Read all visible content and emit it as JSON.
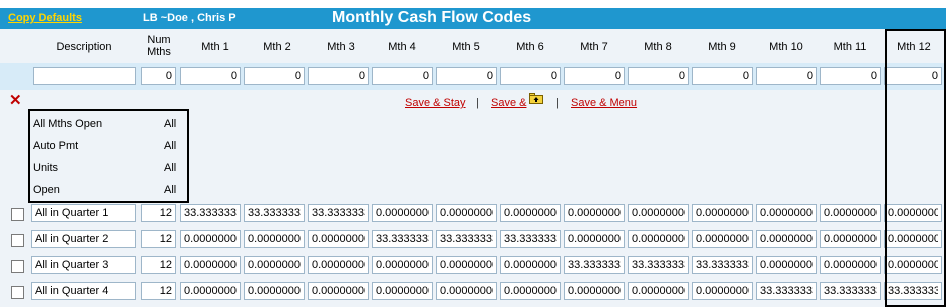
{
  "header": {
    "copy_defaults": "Copy Defaults",
    "user": "LB ~Doe , Chris P",
    "title": "Monthly Cash Flow Codes"
  },
  "columns": {
    "description": "Description",
    "num_mths": "Num Mths",
    "months": [
      "Mth 1",
      "Mth 2",
      "Mth 3",
      "Mth 4",
      "Mth 5",
      "Mth 6",
      "Mth 7",
      "Mth 8",
      "Mth 9",
      "Mth 10",
      "Mth 11",
      "Mth 12"
    ]
  },
  "input_row": {
    "description": "",
    "num_mths": "0",
    "months": [
      "0",
      "0",
      "0",
      "0",
      "0",
      "0",
      "0",
      "0",
      "0",
      "0",
      "0",
      "0"
    ]
  },
  "actions": {
    "save_stay": "Save & Stay",
    "save_and": "Save &",
    "save_menu": "Save & Menu",
    "separator": "|"
  },
  "options": [
    {
      "label": "All Mths Open",
      "value": "All"
    },
    {
      "label": "Auto Pmt",
      "value": "All"
    },
    {
      "label": "Units",
      "value": "All"
    },
    {
      "label": "Open",
      "value": "All"
    }
  ],
  "rows": [
    {
      "description": "All in Quarter 1",
      "num_mths": "12",
      "months": [
        "33.3333333",
        "33.3333333",
        "33.3333333",
        "0.00000000",
        "0.00000000",
        "0.00000000",
        "0.00000000",
        "0.00000000",
        "0.00000000",
        "0.00000000",
        "0.00000000",
        "0.00000000"
      ]
    },
    {
      "description": "All in Quarter 2",
      "num_mths": "12",
      "months": [
        "0.00000000",
        "0.00000000",
        "0.00000000",
        "33.3333333",
        "33.3333333",
        "33.3333333",
        "0.00000000",
        "0.00000000",
        "0.00000000",
        "0.00000000",
        "0.00000000",
        "0.00000000"
      ]
    },
    {
      "description": "All in Quarter 3",
      "num_mths": "12",
      "months": [
        "0.00000000",
        "0.00000000",
        "0.00000000",
        "0.00000000",
        "0.00000000",
        "0.00000000",
        "33.3333333",
        "33.3333333",
        "33.3333333",
        "0.00000000",
        "0.00000000",
        "0.00000000"
      ]
    },
    {
      "description": "All in Quarter 4",
      "num_mths": "12",
      "months": [
        "0.00000000",
        "0.00000000",
        "0.00000000",
        "0.00000000",
        "0.00000000",
        "0.00000000",
        "0.00000000",
        "0.00000000",
        "0.00000000",
        "33.3333333",
        "33.3333333",
        "33.3333333"
      ]
    }
  ],
  "colors": {
    "title_bar": "#1f97cf",
    "accent_link": "#c00000",
    "copy_defaults": "#ffd500"
  }
}
